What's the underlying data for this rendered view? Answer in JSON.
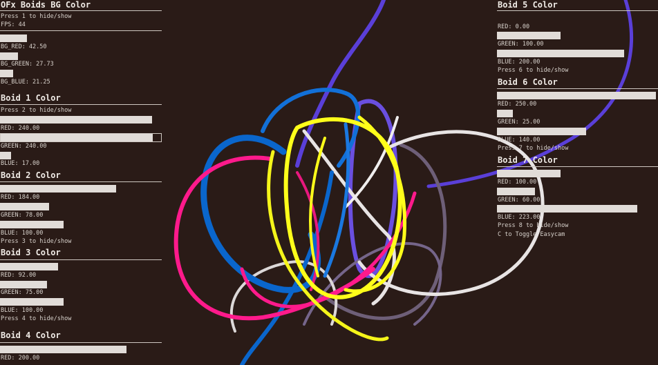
{
  "left": {
    "title": "OFx Boids BG Color",
    "press": "Press 1 to hide/show",
    "fps": "FPS: 44",
    "bg_red": "BG_RED: 42.50",
    "bg_green": "BG_GREEN: 27.73",
    "bg_blue": "BG_BLUE: 21.25",
    "boid1": {
      "title": "Boid 1 Color",
      "press": "Press 2 to hide/show",
      "red": "RED: 240.00",
      "green": "GREEN: 240.00",
      "blue": "BLUE: 17.00"
    },
    "boid2": {
      "title": "Boid 2 Color",
      "red": "RED: 184.00",
      "green": "GREEN: 78.00",
      "blue": "BLUE: 100.00",
      "press": "Press 3 to hide/show"
    },
    "boid3": {
      "title": "Boid 3 Color",
      "red": "RED: 92.00",
      "green": "GREEN: 75.00",
      "blue": "BLUE: 100.00",
      "press": "Press 4 to hide/show"
    },
    "boid4": {
      "title": "Boid 4 Color",
      "red": "RED: 200.00"
    }
  },
  "right": {
    "boid5": {
      "title": "Boid 5 Color",
      "red": "RED: 0.00",
      "green": "GREEN: 100.00",
      "blue": "BLUE: 200.00",
      "press": "Press 6 to hide/show"
    },
    "boid6": {
      "title": "Boid 6 Color",
      "red": "RED: 250.00",
      "green": "GREEN: 25.00",
      "blue": "BLUE: 140.00",
      "press": "Press 7 to hide/show"
    },
    "boid7": {
      "title": "Boid 7 Color",
      "red": "RED: 100.00",
      "green": "GREEN: 60.00",
      "blue": "BLUE: 223.00",
      "press": "Press 8 to hide/show",
      "toggle": "C to Toggle Easycam"
    }
  },
  "slider_values": {
    "bg_red": 0.17,
    "bg_green": 0.11,
    "bg_blue": 0.08,
    "boid1_red": 0.94,
    "boid1_green": 0.94,
    "boid1_blue": 0.07,
    "boid2_red": 0.72,
    "boid2_green": 0.31,
    "boid2_blue": 0.39,
    "boid3_red": 0.36,
    "boid3_green": 0.29,
    "boid3_blue": 0.39,
    "boid4_red": 0.78,
    "boid5_red": 0.0,
    "boid5_green": 0.39,
    "boid5_blue": 0.78,
    "boid6_red": 0.98,
    "boid6_green": 0.1,
    "boid6_blue": 0.55,
    "boid7_red": 0.39,
    "boid7_green": 0.24,
    "boid7_blue": 0.87
  },
  "colors": {
    "background": "#2a1b17",
    "text": "#e8e2dc",
    "slider": "#e1dcd8",
    "trail_blue": "#0a66cc",
    "trail_yellow": "#ffff1a",
    "trail_magenta": "#ff1a8c",
    "trail_purple": "#5a3fd8",
    "trail_white": "#e8e4e4",
    "trail_grey": "#6e5f78"
  }
}
